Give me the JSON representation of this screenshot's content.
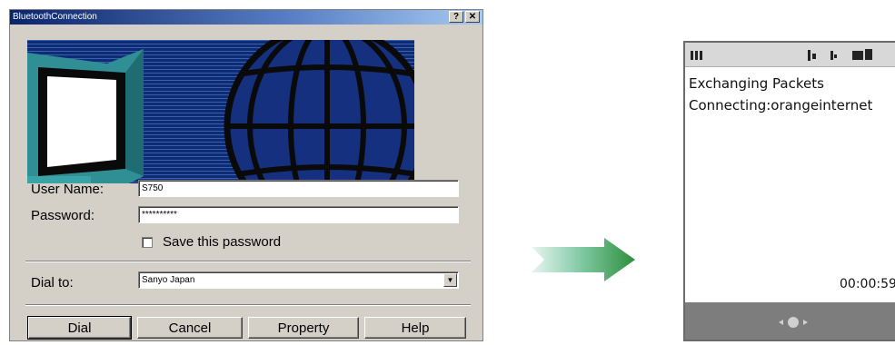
{
  "dialog": {
    "title": "BluetoothConnection",
    "help_button": "?",
    "close_button": "✕",
    "user_name_label": "User Name:",
    "user_name_value": "S750",
    "password_label": "Password:",
    "password_value": "**********",
    "save_password_label": "Save this password",
    "dial_to_label": "Dial to:",
    "dial_to_value": "Sanyo Japan",
    "buttons": [
      "Dial",
      "Cancel",
      "Property",
      "Help"
    ]
  },
  "phone": {
    "line1": "Exchanging Packets",
    "line2": "Connecting:orangeinternet",
    "timer": "00:00:59"
  }
}
